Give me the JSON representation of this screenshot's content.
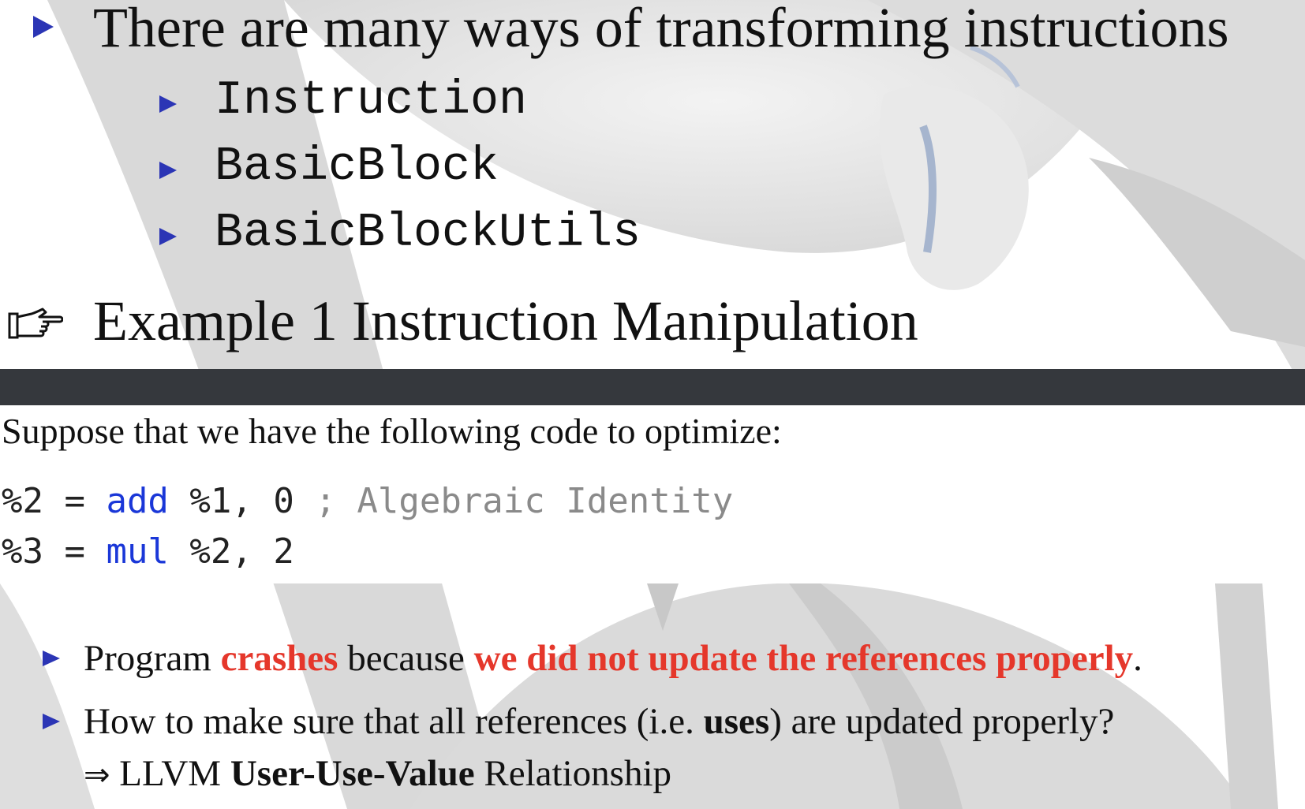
{
  "slide": {
    "intro_bullet": "There are many ways of transforming instructions",
    "sub_items": [
      "Instruction",
      "BasicBlock",
      "BasicBlockUtils"
    ],
    "example_heading": "Example 1 Instruction Manipulation"
  },
  "content": {
    "lead": "Suppose that we have the following code to optimize:",
    "code": {
      "line1": {
        "lhs": "%2 = ",
        "op": "add",
        "args": " %1, 0 ",
        "comment": "; Algebraic Identity"
      },
      "line2": {
        "lhs": "%3 = ",
        "op": "mul",
        "args": " %2, 2"
      }
    },
    "bullet1": {
      "t1": "Program ",
      "t2": "crashes",
      "t3": " because ",
      "t4": "we did not update the references properly",
      "t5": "."
    },
    "bullet2": {
      "t1": "How to make sure that all references (i.e. ",
      "t2": "uses",
      "t3": ") are updated properly?"
    },
    "conclusion": {
      "arrow": "⇒",
      "t1": " LLVM ",
      "t2": "User-Use-Value",
      "t3": " Relationship"
    }
  },
  "colors": {
    "bullet": "#2b35b5",
    "keyword": "#1a37d8",
    "comment": "#8a8a8a",
    "emphasis": "#e5372b",
    "bar": "#35383d"
  },
  "icons": [
    "triangle-bullet-icon",
    "pointing-hand-icon",
    "dragon-watermark-icon"
  ]
}
